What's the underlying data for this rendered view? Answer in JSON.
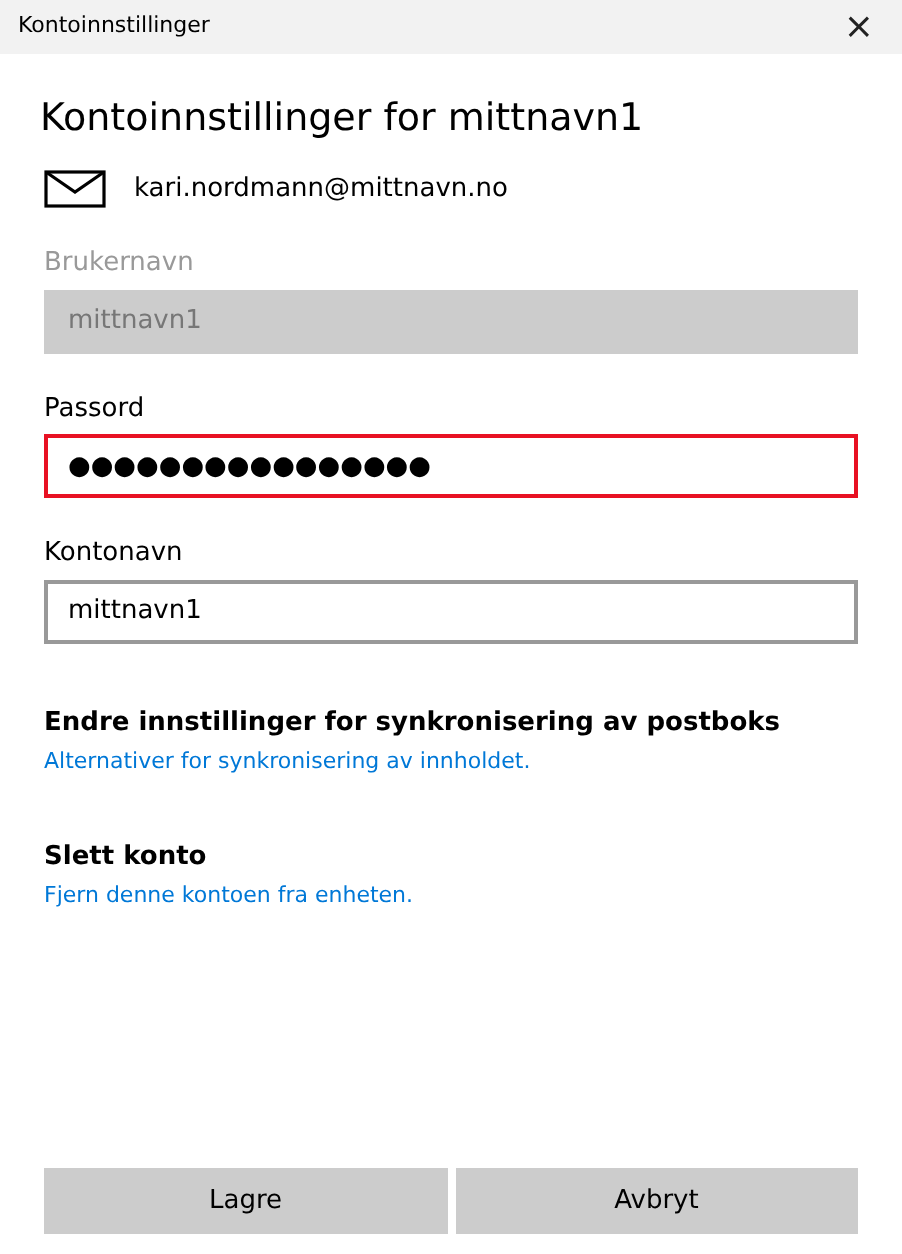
{
  "window": {
    "title": "Kontoinnstillinger",
    "close": "×"
  },
  "heading": "Kontoinnstillinger for mittnavn1",
  "account": {
    "email": "kari.nordmann@mittnavn.no"
  },
  "fields": [
    {
      "label": "Brukernavn",
      "value": "mittnavn1",
      "disabled": true,
      "highlighted": false
    },
    {
      "label": "Passord",
      "value": "●●●●●●●●●●●●●●●●",
      "disabled": false,
      "highlighted": true
    },
    {
      "label": "Kontonavn",
      "value": "mittnavn1",
      "disabled": false,
      "highlighted": false
    }
  ],
  "sections": [
    {
      "title": "Endre innstillinger for synkronisering av postboks",
      "link": "Alternativer for synkronisering av innholdet."
    },
    {
      "title": "Slett konto",
      "link": "Fjern denne kontoen fra enheten."
    }
  ],
  "buttons": [
    "Lagre",
    "Avbryt"
  ]
}
